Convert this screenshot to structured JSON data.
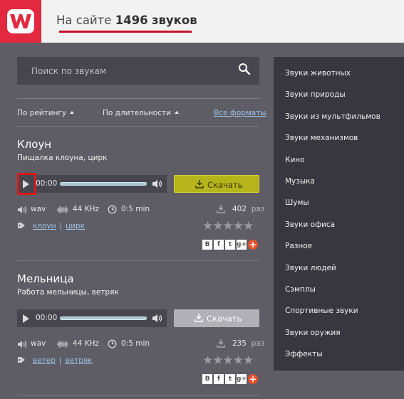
{
  "header": {
    "count_prefix": "На сайте",
    "count_value": "1496",
    "count_suffix": "звуков"
  },
  "search": {
    "placeholder": "Поиск по звукам"
  },
  "sort": {
    "by_rating": "По рейтингу",
    "by_duration": "По длительности",
    "all_formats": "Все форматы"
  },
  "sounds": [
    {
      "title": "Клоун",
      "description": "Пищалка клоуна, цирк",
      "time": "00:00",
      "download_label": "Скачать",
      "format": "wav",
      "bitrate": "44 KHz",
      "duration": "0:5 min",
      "downloads": "402",
      "downloads_unit": "раз",
      "tags": [
        "клоун",
        "цирк"
      ],
      "rating": 0
    },
    {
      "title": "Мельница",
      "description": "Работа мельницы, ветряк",
      "time": "00:00",
      "download_label": "Скачать",
      "format": "wav",
      "bitrate": "44 KHz",
      "duration": "0:5 min",
      "downloads": "235",
      "downloads_unit": "раз",
      "tags": [
        "ветер",
        "ветряк"
      ],
      "rating": 0
    }
  ],
  "share": {
    "vk": "В",
    "fb": "f",
    "tw": "t",
    "gp": "g+",
    "more": "+"
  },
  "sidebar": {
    "items": [
      "Звуки животных",
      "Звуки природы",
      "Звуки из мультфильмов",
      "Звуки механизмов",
      "Кино",
      "Музыка",
      "Шумы",
      "Звуки офиса",
      "Разное",
      "Звуки людей",
      "Сэмплы",
      "Спортивные звуки",
      "Звуки оружия",
      "Эффекты"
    ]
  },
  "colors": {
    "brand_red": "#e2293f",
    "download_active": "#b5b41b",
    "link_blue": "#9ec4e8"
  }
}
